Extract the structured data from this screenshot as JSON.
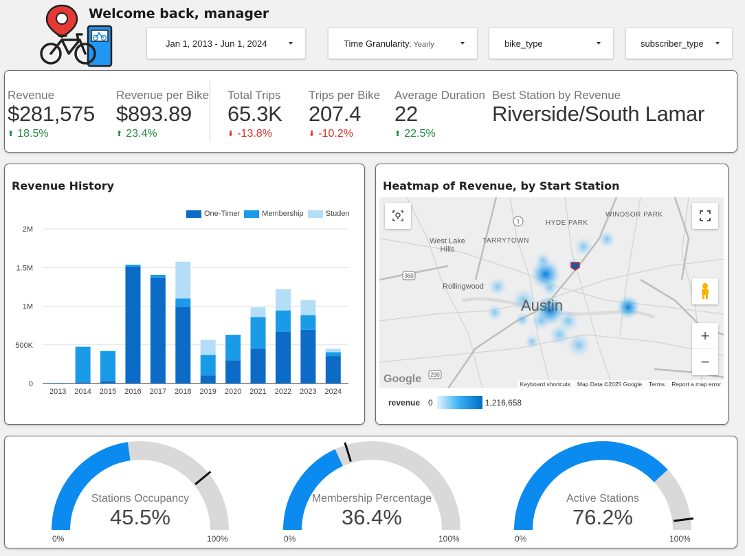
{
  "header": {
    "welcome": "Welcome back, manager",
    "logo_icon": "bike-station-logo-icon"
  },
  "filters": {
    "date_range": "Jan 1, 2013 - Jun 1, 2024",
    "granularity_label": "Time Granularity",
    "granularity_value": "Yearly",
    "bike_type": "bike_type",
    "subscriber_type": "subscriber_type"
  },
  "kpis": [
    {
      "label": "Revenue",
      "value": "$281,575",
      "change": "18.5%",
      "direction": "up"
    },
    {
      "label": "Revenue per Bike",
      "value": "$893.89",
      "change": "23.4%",
      "direction": "up"
    },
    {
      "label": "Total Trips",
      "value": "65.3K",
      "change": "-13.8%",
      "direction": "down"
    },
    {
      "label": "Trips per Bike",
      "value": "207.4",
      "change": "-10.2%",
      "direction": "down"
    },
    {
      "label": "Average Duration",
      "value": "22",
      "change": "22.5%",
      "direction": "up"
    },
    {
      "label": "Best Station by Revenue",
      "value": "Riverside/South Lamar"
    }
  ],
  "revenue_history": {
    "title": "Revenue History"
  },
  "chart_data": {
    "type": "bar",
    "stacked": true,
    "categories": [
      "2013",
      "2014",
      "2015",
      "2016",
      "2017",
      "2018",
      "2019",
      "2020",
      "2021",
      "2022",
      "2023",
      "2024"
    ],
    "series": [
      {
        "name": "One-Timer",
        "color": "#0b6bc6",
        "values": [
          5000,
          15000,
          30000,
          1510000,
          1370000,
          990000,
          105000,
          300000,
          450000,
          670000,
          695000,
          355000
        ]
      },
      {
        "name": "Membership",
        "color": "#199be8",
        "values": [
          2000,
          460000,
          390000,
          25000,
          35000,
          110000,
          265000,
          330000,
          410000,
          275000,
          190000,
          50000
        ]
      },
      {
        "name": "Studen",
        "color": "#b4def8",
        "values": [
          0,
          0,
          0,
          0,
          0,
          475000,
          195000,
          0,
          125000,
          275000,
          195000,
          45000
        ]
      }
    ],
    "y_ticks": [
      "0",
      "500K",
      "1M",
      "1.5M",
      "2M"
    ],
    "ylim": [
      0,
      2000000
    ],
    "grid": true,
    "legend_position": "top-right"
  },
  "heatmap": {
    "title": "Heatmap of Revenue, by Start Station",
    "city_label": "Austin",
    "places": [
      "West Lake Hills",
      "TARRYTOWN",
      "HYDE PARK",
      "WINDSOR PARK",
      "Rollingwood"
    ],
    "road_shields": [
      "1",
      "360",
      "290"
    ],
    "attribution": [
      "Keyboard shortcuts",
      "Map Data ©2025 Google",
      "Terms",
      "Report a map error"
    ],
    "google_logo": "Google",
    "scale_label": "revenue",
    "scale_min": "0",
    "scale_max": "1,216,658",
    "zoom_in": "+",
    "zoom_out": "−"
  },
  "gauges": [
    {
      "label": "Stations Occupancy",
      "value": "45.5%",
      "fraction": 0.455,
      "target": 0.78,
      "min": "0%",
      "max": "100%"
    },
    {
      "label": "Membership Percentage",
      "value": "36.4%",
      "fraction": 0.364,
      "target": 0.405,
      "min": "0%",
      "max": "100%"
    },
    {
      "label": "Active Stations",
      "value": "76.2%",
      "fraction": 0.762,
      "target": 0.96,
      "min": "0%",
      "max": "100%"
    }
  ],
  "colors": {
    "accent_blue": "#0b8bf0",
    "gauge_track": "#d9d9d9",
    "positive": "#1e8a3e",
    "negative": "#d93025"
  }
}
